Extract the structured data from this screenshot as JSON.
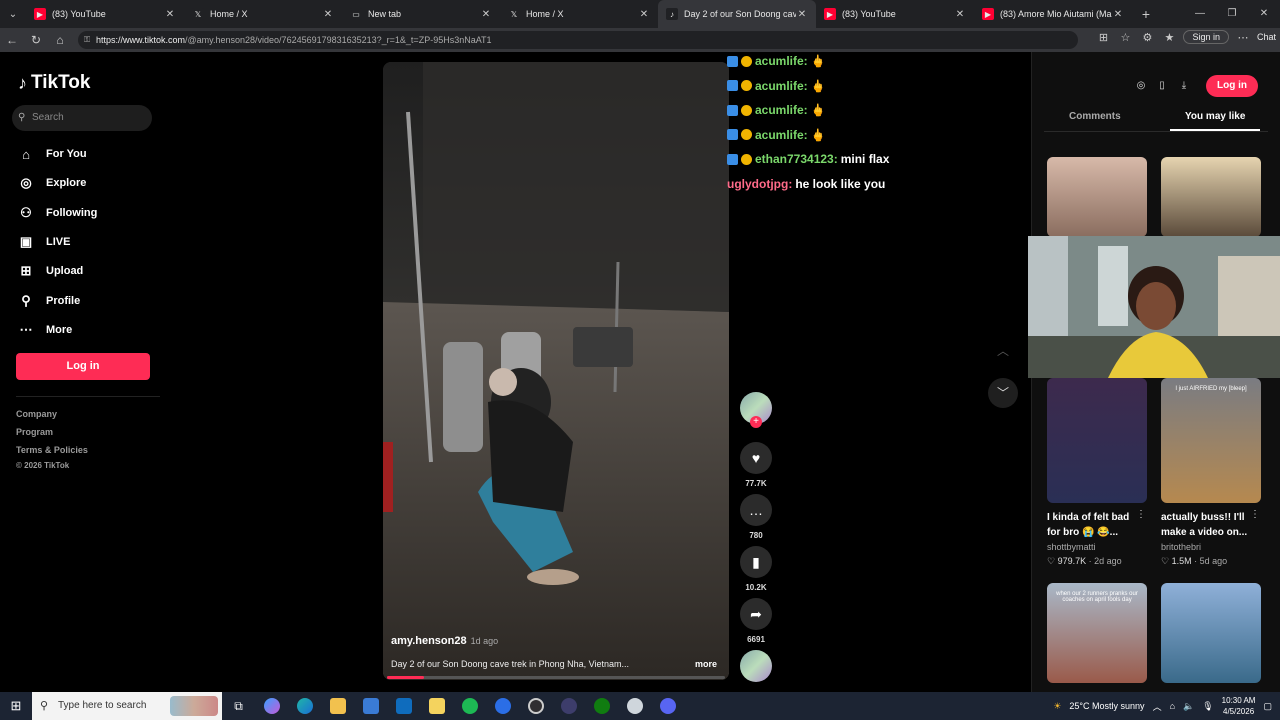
{
  "browser": {
    "tabs": [
      {
        "title": "(83) YouTube",
        "icon": "youtube-icon",
        "color": "#ff0033",
        "active": false
      },
      {
        "title": "Home / X",
        "icon": "x-icon",
        "color": "#202124",
        "active": false
      },
      {
        "title": "New tab",
        "icon": "newtab-icon",
        "color": "#202124",
        "active": false
      },
      {
        "title": "Home / X",
        "icon": "x-icon",
        "color": "#202124",
        "active": false
      },
      {
        "title": "Day 2 of our Son Doong cave",
        "icon": "tiktok-icon",
        "color": "#202124",
        "active": true
      },
      {
        "title": "(83) YouTube",
        "icon": "youtube-icon",
        "color": "#ff0033",
        "active": false
      },
      {
        "title": "(83) Amore Mio Aiutami (Main Th",
        "icon": "youtube-icon",
        "color": "#ff0033",
        "active": false
      }
    ],
    "url_domain": "https://www.tiktok.com",
    "url_path": "/@amy.henson28/video/7624569179831635213?_r=1&_t=ZP-95Hs3nNaAT1",
    "signin_label": "Sign in",
    "chat_label": "Chat"
  },
  "sidebar": {
    "logo": "TikTok",
    "search_placeholder": "Search",
    "nav": [
      {
        "label": "For You",
        "icon": "home-icon"
      },
      {
        "label": "Explore",
        "icon": "compass-icon"
      },
      {
        "label": "Following",
        "icon": "following-icon"
      },
      {
        "label": "LIVE",
        "icon": "live-icon"
      },
      {
        "label": "Upload",
        "icon": "upload-icon"
      },
      {
        "label": "Profile",
        "icon": "profile-icon"
      },
      {
        "label": "More",
        "icon": "more-icon"
      }
    ],
    "login_label": "Log in",
    "footer_links": [
      "Company",
      "Program",
      "Terms & Policies"
    ],
    "copyright": "© 2026 TikTok"
  },
  "video": {
    "username": "amy.henson28",
    "age": "1d ago",
    "description": "Day 2 of our Son Doong cave trek in Phong Nha, Vietnam...",
    "more_label": "more",
    "progress": 0.11,
    "likes": "77.7K",
    "comments": "780",
    "saves": "10.2K",
    "shares": "6691"
  },
  "chat": [
    {
      "user": "acumlife:",
      "msg": "🖕",
      "user_color": "#7bd86b"
    },
    {
      "user": "acumlife:",
      "msg": "🖕",
      "user_color": "#7bd86b"
    },
    {
      "user": "acumlife:",
      "msg": "🖕",
      "user_color": "#7bd86b"
    },
    {
      "user": "acumlife:",
      "msg": "🖕",
      "user_color": "#7bd86b"
    },
    {
      "user": "ethan7734123:",
      "msg": "mini flax",
      "user_color": "#7bd86b"
    },
    {
      "user": "uglydotjpg:",
      "msg": "he look like you",
      "user_color": "#ff6b8a"
    }
  ],
  "right_panel": {
    "login_label": "Log in",
    "tabs": [
      "Comments",
      "You may like"
    ],
    "active_tab": "You may like",
    "cards": [
      {
        "title": "I kinda of felt bad for bro 😭 😂...",
        "user": "shottbymatti",
        "stat": "979.7K",
        "ago": "2d ago"
      },
      {
        "title": "actually buss!! I'll make a video on...",
        "user": "britothebri",
        "stat": "1.5M",
        "ago": "5d ago"
      }
    ],
    "thumb_captions": [
      "I just AIRFRIED my [bleep]",
      "when our 2 runners pranks our coaches on april fools day"
    ]
  },
  "taskbar": {
    "search_placeholder": "Type here to search",
    "weather": "25°C  Mostly sunny",
    "time": "10:30 AM",
    "date": "4/5/2026"
  }
}
